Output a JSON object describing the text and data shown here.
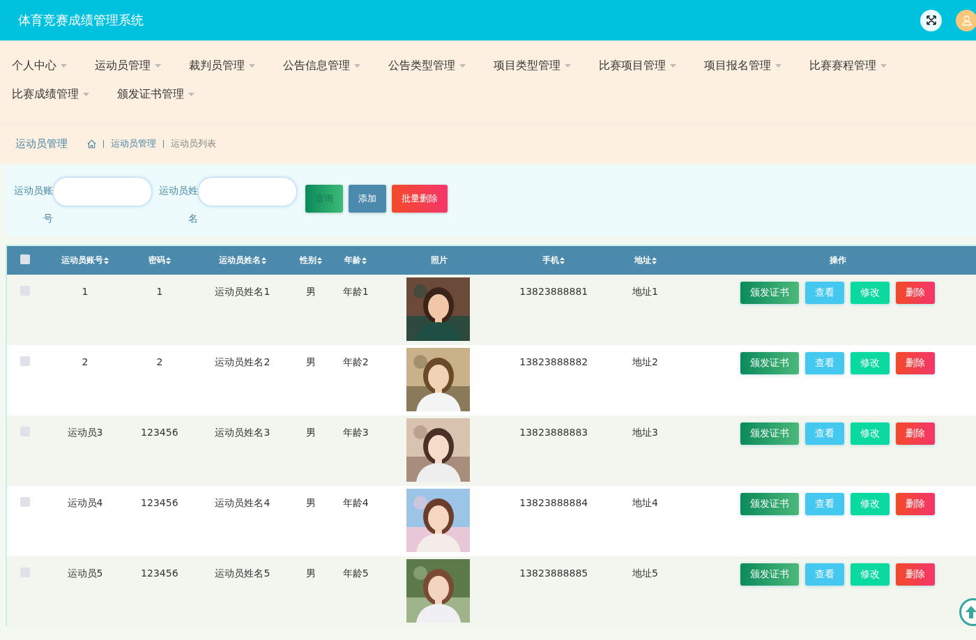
{
  "header": {
    "title": "体育竞赛成绩管理系统"
  },
  "nav": [
    {
      "label": "个人中心"
    },
    {
      "label": "运动员管理"
    },
    {
      "label": "裁判员管理"
    },
    {
      "label": "公告信息管理"
    },
    {
      "label": "公告类型管理"
    },
    {
      "label": "项目类型管理"
    },
    {
      "label": "比赛项目管理"
    },
    {
      "label": "项目报名管理"
    },
    {
      "label": "比赛赛程管理"
    },
    {
      "label": "比赛成绩管理"
    },
    {
      "label": "颁发证书管理"
    }
  ],
  "breadcrumb": {
    "title": "运动员管理",
    "items": [
      "运动员管理",
      "运动员列表"
    ]
  },
  "search": {
    "fields": [
      {
        "label": "运动员账号"
      },
      {
        "label": "运动员姓名"
      }
    ],
    "buttons": [
      {
        "label": "查询",
        "kind": "search"
      },
      {
        "label": "添加",
        "kind": "add"
      },
      {
        "label": "批量删除",
        "kind": "delete"
      }
    ]
  },
  "table": {
    "select_all": {
      "checked": false
    },
    "columns": [
      {
        "label": "运动员账号",
        "sortable": true
      },
      {
        "label": "密码",
        "sortable": true
      },
      {
        "label": "运动员姓名",
        "sortable": true
      },
      {
        "label": "性别",
        "sortable": true
      },
      {
        "label": "年龄",
        "sortable": true
      },
      {
        "label": "照片",
        "sortable": false
      },
      {
        "label": "手机",
        "sortable": true
      },
      {
        "label": "地址",
        "sortable": true
      },
      {
        "label": "操作",
        "sortable": false
      }
    ],
    "rows": [
      {
        "checked": false,
        "cells": [
          "1",
          "1",
          "运动员姓名1",
          "男",
          "年龄1",
          {
            "kind": "picture"
          },
          "13823888881",
          "地址1"
        ],
        "actions": [
          {
            "label": "颁发证书",
            "kind": "issue"
          },
          {
            "label": "查看",
            "kind": "view"
          },
          {
            "label": "修改",
            "kind": "edit"
          },
          {
            "label": "删除",
            "kind": "delete"
          }
        ]
      },
      {
        "checked": false,
        "cells": [
          "2",
          "2",
          "运动员姓名2",
          "男",
          "年龄2",
          {
            "kind": "picture"
          },
          "13823888882",
          "地址2"
        ],
        "actions": [
          {
            "label": "颁发证书",
            "kind": "issue"
          },
          {
            "label": "查看",
            "kind": "view"
          },
          {
            "label": "修改",
            "kind": "edit"
          },
          {
            "label": "删除",
            "kind": "delete"
          }
        ]
      },
      {
        "checked": false,
        "cells": [
          "运动员3",
          "123456",
          "运动员姓名3",
          "男",
          "年龄3",
          {
            "kind": "picture"
          },
          "13823888883",
          "地址3"
        ],
        "actions": [
          {
            "label": "颁发证书",
            "kind": "issue"
          },
          {
            "label": "查看",
            "kind": "view"
          },
          {
            "label": "修改",
            "kind": "edit"
          },
          {
            "label": "删除",
            "kind": "delete"
          }
        ]
      },
      {
        "checked": false,
        "cells": [
          "运动员4",
          "123456",
          "运动员姓名4",
          "男",
          "年龄4",
          {
            "kind": "picture"
          },
          "13823888884",
          "地址4"
        ],
        "actions": [
          {
            "label": "颁发证书",
            "kind": "issue"
          },
          {
            "label": "查看",
            "kind": "view"
          },
          {
            "label": "修改",
            "kind": "edit"
          },
          {
            "label": "删除",
            "kind": "delete"
          }
        ]
      },
      {
        "checked": false,
        "cells": [
          "运动员5",
          "123456",
          "运动员姓名5",
          "男",
          "年龄5",
          {
            "kind": "picture"
          },
          "13823888885",
          "地址5"
        ],
        "actions": [
          {
            "label": "颁发证书",
            "kind": "issue"
          },
          {
            "label": "查看",
            "kind": "view"
          },
          {
            "label": "修改",
            "kind": "edit"
          },
          {
            "label": "删除",
            "kind": "delete"
          }
        ]
      }
    ]
  }
}
